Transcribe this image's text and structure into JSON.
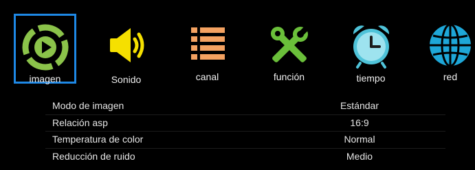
{
  "menu": {
    "tabs": [
      {
        "label": "imagen",
        "icon": "play-icon",
        "color": "#8bc34a",
        "selected": true
      },
      {
        "label": "Sonido",
        "icon": "speaker-icon",
        "color": "#f5e000",
        "selected": false
      },
      {
        "label": "canal",
        "icon": "list-icon",
        "color": "#f4a261",
        "selected": false
      },
      {
        "label": "función",
        "icon": "tools-icon",
        "color": "#6abf3a",
        "selected": false
      },
      {
        "label": "tiempo",
        "icon": "alarm-clock-icon",
        "color": "#4fc3d9",
        "selected": false
      },
      {
        "label": "red",
        "icon": "globe-icon",
        "color": "#1ea7d8",
        "selected": false
      }
    ],
    "selection_color": "#1e88e5"
  },
  "settings": [
    {
      "name": "Modo de imagen",
      "value": "Estándar"
    },
    {
      "name": "Relación asp",
      "value": "16:9"
    },
    {
      "name": "Temperatura de color",
      "value": "Normal"
    },
    {
      "name": "Reducción de ruido",
      "value": "Medio"
    }
  ]
}
